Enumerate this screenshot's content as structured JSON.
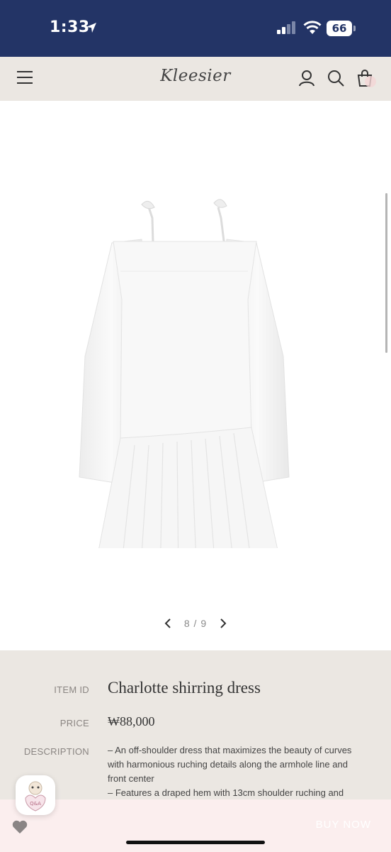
{
  "status_bar": {
    "time": "1:33",
    "battery": "66"
  },
  "header": {
    "brand": "Kleesier"
  },
  "gallery": {
    "page_indicator": "8 / 9"
  },
  "product": {
    "item_id_label": "ITEM ID",
    "name": "Charlotte shirring dress",
    "price_label": "PRICE",
    "price": "₩88,000",
    "description_label": "DESCRIPTION",
    "description_lines": [
      "– An off-shoulder dress that maximizes the beauty of curves",
      "with harmonious ruching details along the armhole line and",
      "front center",
      "– Features a draped hem with 13cm shoulder ruching and"
    ]
  },
  "bottom_bar": {
    "buy_now_label": "BUY NOW"
  },
  "colors": {
    "status_bar_bg": "#233466",
    "header_bg": "#ebe7e2",
    "bottom_bar_bg": "#fbeeee"
  },
  "icons": [
    "location-arrow-icon",
    "signal-icon",
    "wifi-icon",
    "battery-icon",
    "menu-icon",
    "user-icon",
    "search-icon",
    "cart-icon",
    "chevron-left-icon",
    "chevron-right-icon",
    "heart-icon",
    "qna-badge-icon"
  ]
}
